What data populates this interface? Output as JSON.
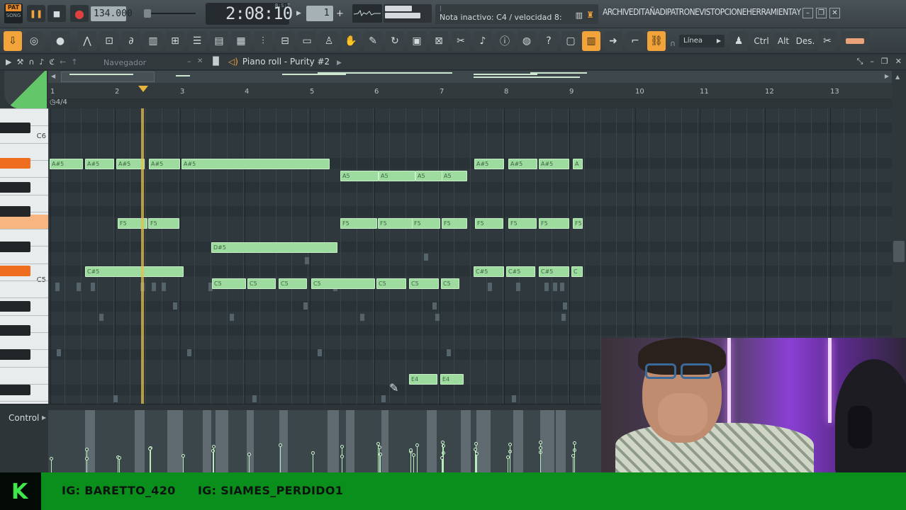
{
  "transport": {
    "pat_label": "PAT",
    "song_label": "SONG",
    "tempo": "134.000",
    "time": "2:08:10",
    "time_unit": "B:S:T",
    "pattern_number": "1",
    "hint": "Nota inactivo: C4 / velocidad 8:",
    "hint_tick": "|"
  },
  "menu": [
    "ARCHIV",
    "EDIT",
    "AÑADI",
    "PATRON",
    "EVISTO",
    "PCIONE",
    "HERRAMIENTA",
    "Y"
  ],
  "toolbar": {
    "snap": "Línea",
    "ctrl": "Ctrl",
    "alt": "Alt",
    "des": "Des."
  },
  "piano_roll": {
    "navigator_label": "Navegador",
    "title": "Piano roll - Purity #2",
    "time_signature": "4/4",
    "bars": [
      "1",
      "2",
      "3",
      "4",
      "5",
      "6",
      "7",
      "8",
      "9",
      "10",
      "11",
      "12",
      "13"
    ],
    "key_labels": {
      "c6": "C6",
      "c5": "C5"
    },
    "notes": [
      {
        "label": "A#5"
      },
      {
        "label": "A#5"
      },
      {
        "label": "A#5"
      },
      {
        "label": "A#5"
      },
      {
        "label": "A#5"
      },
      {
        "label": "A5"
      },
      {
        "label": "A5"
      },
      {
        "label": "A5"
      },
      {
        "label": "A5"
      },
      {
        "label": "A#5"
      },
      {
        "label": "A#5"
      },
      {
        "label": "A#5"
      },
      {
        "label": "A"
      },
      {
        "label": "F5"
      },
      {
        "label": "F5"
      },
      {
        "label": "F5"
      },
      {
        "label": "F5"
      },
      {
        "label": "F5"
      },
      {
        "label": "F5"
      },
      {
        "label": "F5"
      },
      {
        "label": "F5"
      },
      {
        "label": "F5"
      },
      {
        "label": "F5"
      },
      {
        "label": "D#5"
      },
      {
        "label": "C#5"
      },
      {
        "label": "C#5"
      },
      {
        "label": "C#5"
      },
      {
        "label": "C#5"
      },
      {
        "label": "C"
      },
      {
        "label": "C5"
      },
      {
        "label": "C5"
      },
      {
        "label": "C5"
      },
      {
        "label": "C5"
      },
      {
        "label": "C5"
      },
      {
        "label": "C5"
      },
      {
        "label": "C5"
      },
      {
        "label": "E4"
      },
      {
        "label": "E4"
      }
    ]
  },
  "control": {
    "label": "Control"
  },
  "banner": {
    "logo": "K",
    "ig1": "IG: BARETTO_420",
    "ig2": "IG: SIAMES_PERDIDO1"
  },
  "colors": {
    "accent": "#f2a33a",
    "note": "#9edb9e",
    "banner": "#0a8f1c"
  }
}
